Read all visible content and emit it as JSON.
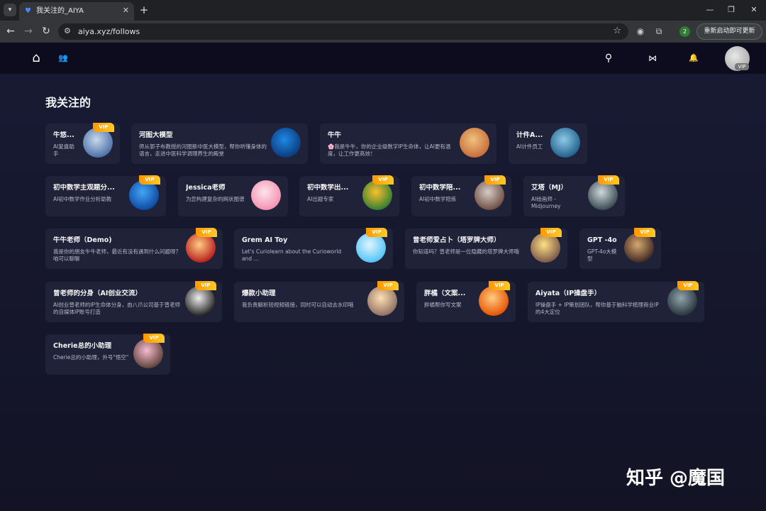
{
  "browser": {
    "tab_title": "我关注的_AIYA",
    "tab_close": "✕",
    "new_tab": "+",
    "url": "aiya.xyz/follows",
    "profile_badge": "2",
    "update_button": "重新启动即可更新",
    "window": {
      "minimize": "—",
      "restore": "❐",
      "close": "✕"
    }
  },
  "icons": {
    "back": "←",
    "forward": "→",
    "reload": "↻",
    "site_info": "⚙",
    "star": "☆",
    "extension_a": "◉",
    "extension_b": "⧉",
    "home": "⌂",
    "users": "👥",
    "search": "⚲",
    "share": "⋈",
    "bell": "🔔"
  },
  "header": {
    "avatar_badge": "VIP"
  },
  "page": {
    "title": "我关注的"
  },
  "vip_label": "VIP",
  "cards": [
    {
      "name": "牛悠...",
      "desc": "AI复盘助手",
      "avatar_colors": [
        "#4a6fa5",
        "#c9d9ee"
      ],
      "vip": true
    },
    {
      "name": "河图大模型",
      "desc": "师从郭子布教授的河图新中医大模型，帮你听懂身体的语言，走进中医科学调理养生的殿堂",
      "avatar_colors": [
        "#0b3a7a",
        "#1e88e5"
      ],
      "vip": false
    },
    {
      "name": "牛牛",
      "desc": "🌸我是牛牛，你的企业级数字IP生命体，让AI更有温度，让工作更高效！",
      "avatar_colors": [
        "#c76b3a",
        "#f1c27d"
      ],
      "vip": false
    },
    {
      "name": "计件A...",
      "desc": "AI计件员工",
      "avatar_colors": [
        "#1f5f8b",
        "#8ecae6"
      ],
      "vip": false
    },
    {
      "name": "初中数学主观题分...",
      "desc": "AI初中数学作业分析助教",
      "avatar_colors": [
        "#0d47a1",
        "#42a5f5"
      ],
      "vip": true
    },
    {
      "name": "Jessica老师",
      "desc": "为您构建复杂的网状图谱",
      "avatar_colors": [
        "#f48fb1",
        "#fce4ec"
      ],
      "vip": false
    },
    {
      "name": "初中数学出...",
      "desc": "AI出题专家",
      "avatar_colors": [
        "#2e7d32",
        "#fbc02d"
      ],
      "vip": true
    },
    {
      "name": "初中数学陪...",
      "desc": "AI初中数学陪练",
      "avatar_colors": [
        "#6d4c41",
        "#d7ccc8"
      ],
      "vip": true
    },
    {
      "name": "艾塔（MJ）",
      "desc": "AI绘画师 - Midjourney",
      "avatar_colors": [
        "#37474f",
        "#cfd8dc"
      ],
      "vip": true
    },
    {
      "name": "牛牛老师（Demo)",
      "desc": "我是你的朋友牛牛老师，最近有没有遇到什么问题呀？咱可以聊聊",
      "avatar_colors": [
        "#b71c1c",
        "#ffcc80"
      ],
      "vip": true
    },
    {
      "name": "Grem AI Toy",
      "desc": "Let's Curiolearn about the Curioworld and ...",
      "avatar_colors": [
        "#4fc3f7",
        "#e1f5fe"
      ],
      "vip": true
    },
    {
      "name": "曾老师爱占卜（塔罗牌大师）",
      "desc": "你知道吗？曾老师是一位隐藏的塔罗牌大师哦",
      "avatar_colors": [
        "#795548",
        "#ffe082"
      ],
      "vip": true
    },
    {
      "name": "GPT -4o",
      "desc": "GPT-4o大模型",
      "avatar_colors": [
        "#3e2723",
        "#d7a86e"
      ],
      "vip": true
    },
    {
      "name": "曾老师的分身（AI创业交流）",
      "desc": "AI创业曾老师的IP生命体分身，由八爪公司基于曾老师的自媒体IP账号打造",
      "avatar_colors": [
        "#212121",
        "#eeeeee"
      ],
      "vip": true
    },
    {
      "name": "爆款小助理",
      "desc": "我负责解析短视频链接，同时可以自动去水印哦",
      "avatar_colors": [
        "#8d6e63",
        "#ffe0b2"
      ],
      "vip": true
    },
    {
      "name": "胖橘（文案...",
      "desc": "胖橘帮你写文案",
      "avatar_colors": [
        "#e65100",
        "#ffcc80"
      ],
      "vip": true
    },
    {
      "name": "Aiyata（IP操盘手）",
      "desc": "IP操盘手 + IP策划团队，帮你基于脑科学梳理商业IP的4大定位",
      "avatar_colors": [
        "#263238",
        "#90a4ae"
      ],
      "vip": true
    },
    {
      "name": "Cherie总的小助理",
      "desc": "Cherie总的小助理，外号\"悟空\"",
      "avatar_colors": [
        "#5d4037",
        "#f8bbd0"
      ],
      "vip": true
    }
  ],
  "watermark": "知乎 @魔国"
}
